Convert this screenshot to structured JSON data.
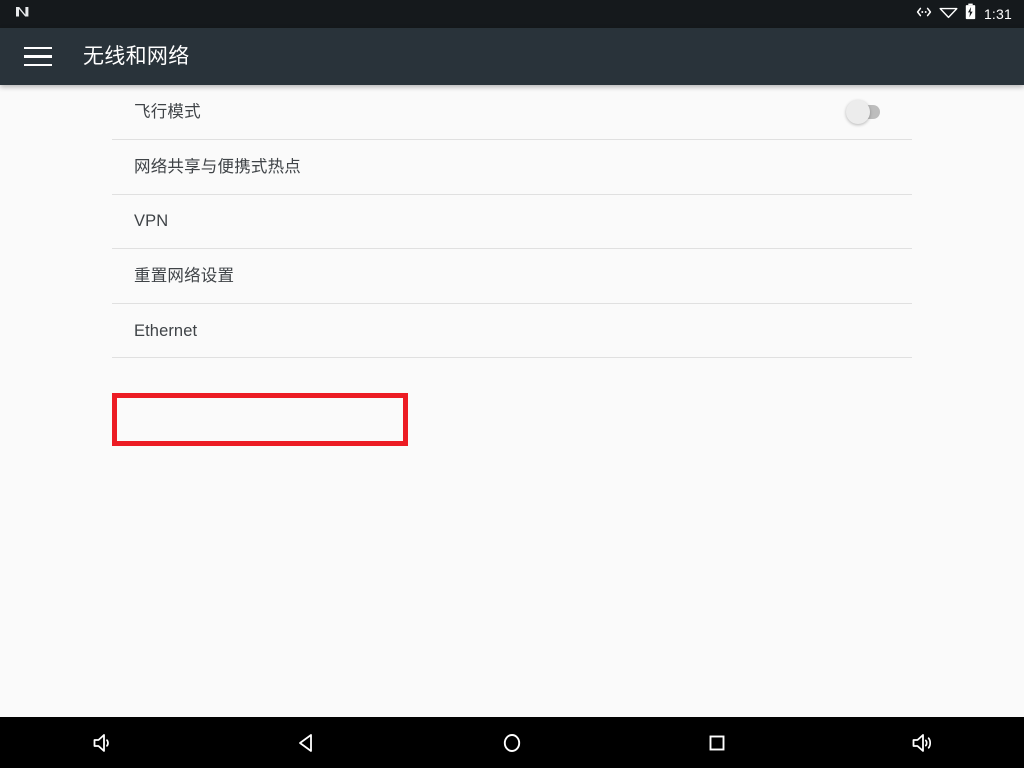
{
  "status_bar": {
    "logo_icon": "android-n-logo",
    "icons": [
      {
        "name": "ethernet-arrows-icon",
        "label": "ethernet"
      },
      {
        "name": "wifi-icon",
        "label": "wifi"
      },
      {
        "name": "battery-charging-icon",
        "label": "battery charging"
      }
    ],
    "time": "1:31",
    "background_color": "#15191c"
  },
  "app_bar": {
    "menu_icon": "hamburger-menu-icon",
    "title": "无线和网络",
    "background_color": "#29333a",
    "text_color": "#ffffff"
  },
  "settings_list": {
    "items": [
      {
        "label": "飞行模式",
        "name": "airplane-mode",
        "control": "switch",
        "switch_state": "off",
        "latin": false
      },
      {
        "label": "网络共享与便携式热点",
        "name": "tethering-hotspot",
        "control": "none",
        "latin": false
      },
      {
        "label": "VPN",
        "name": "vpn",
        "control": "none",
        "latin": true
      },
      {
        "label": "重置网络设置",
        "name": "reset-network-settings",
        "control": "none",
        "latin": false
      },
      {
        "label": "Ethernet",
        "name": "ethernet",
        "control": "none",
        "latin": true,
        "highlighted": true
      }
    ],
    "divider_color": "#e0e0e0",
    "background_color": "#fafafa",
    "text_color": "#3f4347"
  },
  "highlight": {
    "color": "#ec1c24",
    "target_label": "Ethernet"
  },
  "nav_bar": {
    "background_color": "#000000",
    "buttons": [
      {
        "name": "volume-down-icon",
        "label": "volume down"
      },
      {
        "name": "back-icon",
        "label": "back"
      },
      {
        "name": "home-icon",
        "label": "home"
      },
      {
        "name": "recents-icon",
        "label": "recent apps"
      },
      {
        "name": "volume-up-icon",
        "label": "volume up"
      }
    ]
  }
}
